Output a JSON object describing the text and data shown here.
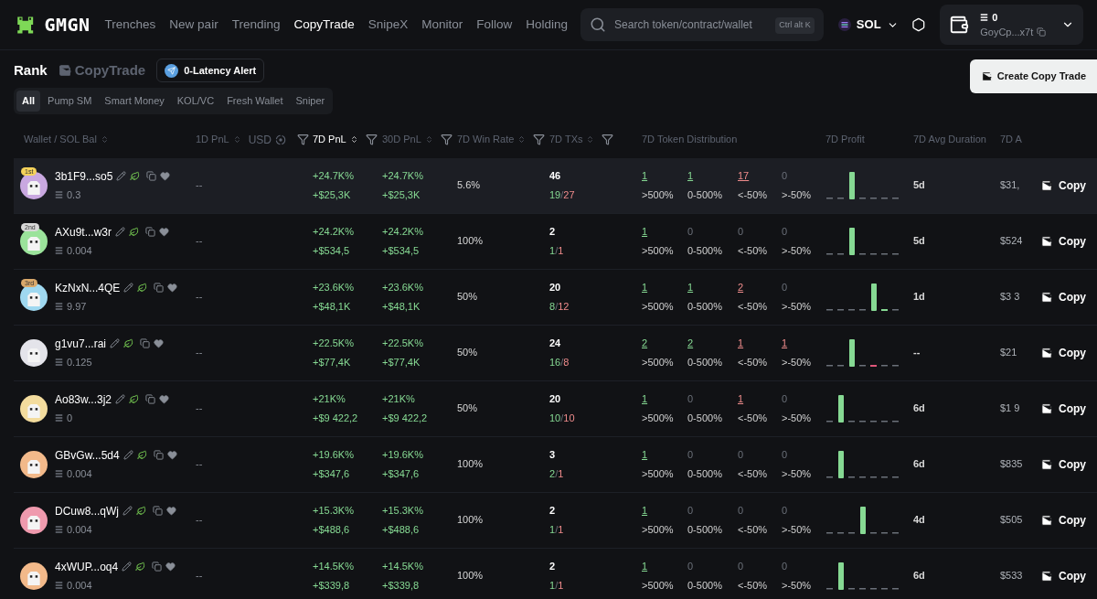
{
  "nav": {
    "logo": "GMGN",
    "links": [
      {
        "label": "Trenches",
        "selected": false
      },
      {
        "label": "New pair",
        "selected": false
      },
      {
        "label": "Trending",
        "selected": false
      },
      {
        "label": "CopyTrade",
        "selected": true
      },
      {
        "label": "SnipeX",
        "selected": false
      },
      {
        "label": "Monitor",
        "selected": false
      },
      {
        "label": "Follow",
        "selected": false
      },
      {
        "label": "Holding",
        "selected": false
      }
    ],
    "search": {
      "placeholder": "Search token/contract/wallet",
      "shortcut": "Ctrl alt K"
    },
    "chain": "SOL",
    "wallet": {
      "balance": "0",
      "address": "GoyCp...x7t"
    }
  },
  "heading": {
    "title": "Rank",
    "subtitle": "CopyTrade",
    "alert_button": "0-Latency Alert",
    "create_button": "Create Copy Trade"
  },
  "filters": [
    {
      "label": "All",
      "selected": true
    },
    {
      "label": "Pump SM",
      "selected": false
    },
    {
      "label": "Smart Money",
      "selected": false
    },
    {
      "label": "KOL/VC",
      "selected": false
    },
    {
      "label": "Fresh Wallet",
      "selected": false
    },
    {
      "label": "Sniper",
      "selected": false
    }
  ],
  "columns": [
    {
      "label": "Wallet / SOL Bal",
      "kind": "sort",
      "selected": false
    },
    {
      "label": "1D PnL",
      "kind": "sort_usd",
      "extra": "USD",
      "selected": false
    },
    {
      "label": "7D PnL",
      "kind": "sort_filter",
      "selected": true
    },
    {
      "label": "30D PnL",
      "kind": "sort_filter",
      "selected": false
    },
    {
      "label": "7D Win Rate",
      "kind": "sort_filter",
      "selected": false
    },
    {
      "label": "7D TXs",
      "kind": "sort_filter",
      "selected": false
    },
    {
      "label": "7D Token Distribution",
      "kind": "plain",
      "selected": false
    },
    {
      "label": "7D Profit",
      "kind": "plain",
      "selected": false
    },
    {
      "label": "7D Avg Duration",
      "kind": "plain",
      "selected": false
    },
    {
      "label": "7D A",
      "kind": "plain",
      "selected": false
    }
  ],
  "rows": [
    {
      "highlighted": true,
      "rank": {
        "label": "1st",
        "color": "#f5d25a"
      },
      "avatar": {
        "color": "#c9a8e0"
      },
      "wallet": "3b1F9...so5",
      "balance": "0.3",
      "pnl_1d": "--",
      "pnl_7d": [
        "+24.7K%",
        "+$25,3K"
      ],
      "pnl_30d": [
        "+24.7K%",
        "+$25,3K"
      ],
      "win_rate": "5.6%",
      "txs": "46",
      "wins": "19",
      "tx_separator": "/",
      "losses": "27",
      "distribution": [
        {
          "value": "1",
          "label": ">500%",
          "kind": "win"
        },
        {
          "value": "1",
          "label": "0-500%",
          "kind": "win"
        },
        {
          "value": "17",
          "label": "<-50%",
          "kind": "loss"
        },
        {
          "value": "0",
          "label": ">-50%",
          "kind": "none"
        }
      ],
      "profit_bars": [
        {
          "kind": "flat"
        },
        {
          "kind": "flat"
        },
        {
          "kind": "gain"
        },
        {
          "kind": "flat"
        },
        {
          "kind": "flat"
        },
        {
          "kind": "flat"
        },
        {
          "kind": "flat"
        }
      ],
      "avg_duration": "5d",
      "col_7d_a": "$31,",
      "copy": "Copy"
    },
    {
      "highlighted": false,
      "rank": {
        "label": "2nd",
        "color": "#d8d8d8"
      },
      "avatar": {
        "color": "#9be39b"
      },
      "wallet": "AXu9t...w3r",
      "balance": "0.004",
      "pnl_1d": "--",
      "pnl_7d": [
        "+24.2K%",
        "+$534,5"
      ],
      "pnl_30d": [
        "+24.2K%",
        "+$534,5"
      ],
      "win_rate": "100%",
      "txs": "2",
      "wins": "1",
      "tx_separator": "/",
      "losses": "1",
      "distribution": [
        {
          "value": "1",
          "label": ">500%",
          "kind": "win"
        },
        {
          "value": "0",
          "label": "0-500%",
          "kind": "none"
        },
        {
          "value": "0",
          "label": "<-50%",
          "kind": "none"
        },
        {
          "value": "0",
          "label": ">-50%",
          "kind": "none"
        }
      ],
      "profit_bars": [
        {
          "kind": "flat"
        },
        {
          "kind": "flat"
        },
        {
          "kind": "gain"
        },
        {
          "kind": "flat"
        },
        {
          "kind": "flat"
        },
        {
          "kind": "flat"
        },
        {
          "kind": "flat"
        }
      ],
      "avg_duration": "5d",
      "col_7d_a": "$524",
      "copy": "Copy"
    },
    {
      "highlighted": false,
      "rank": {
        "label": "3rd",
        "color": "#d9a86a"
      },
      "avatar": {
        "color": "#9fd8f0"
      },
      "wallet": "KzNxN...4QE",
      "balance": "9.97",
      "pnl_1d": "--",
      "pnl_7d": [
        "+23.6K%",
        "+$48,1K"
      ],
      "pnl_30d": [
        "+23.6K%",
        "+$48,1K"
      ],
      "win_rate": "50%",
      "txs": "20",
      "wins": "8",
      "tx_separator": "/",
      "losses": "12",
      "distribution": [
        {
          "value": "1",
          "label": ">500%",
          "kind": "win"
        },
        {
          "value": "1",
          "label": "0-500%",
          "kind": "win"
        },
        {
          "value": "2",
          "label": "<-50%",
          "kind": "loss"
        },
        {
          "value": "0",
          "label": ">-50%",
          "kind": "none"
        }
      ],
      "profit_bars": [
        {
          "kind": "flat"
        },
        {
          "kind": "flat"
        },
        {
          "kind": "flat"
        },
        {
          "kind": "flat"
        },
        {
          "kind": "gain"
        },
        {
          "kind": "small_gain"
        },
        {
          "kind": "flat"
        }
      ],
      "avg_duration": "1d",
      "col_7d_a": "$3 3",
      "copy": "Copy"
    },
    {
      "highlighted": false,
      "rank": null,
      "avatar": {
        "color": "#e4e4ea"
      },
      "wallet": "g1vu7...rai",
      "balance": "0.125",
      "pnl_1d": "--",
      "pnl_7d": [
        "+22.5K%",
        "+$77,4K"
      ],
      "pnl_30d": [
        "+22.5K%",
        "+$77,4K"
      ],
      "win_rate": "50%",
      "txs": "24",
      "wins": "16",
      "tx_separator": "/",
      "losses": "8",
      "distribution": [
        {
          "value": "2",
          "label": ">500%",
          "kind": "win"
        },
        {
          "value": "2",
          "label": "0-500%",
          "kind": "win"
        },
        {
          "value": "1",
          "label": "<-50%",
          "kind": "loss"
        },
        {
          "value": "1",
          "label": ">-50%",
          "kind": "loss"
        }
      ],
      "profit_bars": [
        {
          "kind": "flat"
        },
        {
          "kind": "flat"
        },
        {
          "kind": "gain"
        },
        {
          "kind": "flat"
        },
        {
          "kind": "loss"
        },
        {
          "kind": "flat"
        },
        {
          "kind": "flat"
        }
      ],
      "avg_duration": "--",
      "col_7d_a": "$21",
      "copy": "Copy"
    },
    {
      "highlighted": false,
      "rank": null,
      "avatar": {
        "color": "#f3dc9e"
      },
      "wallet": "Ao83w...3j2",
      "balance": "0",
      "pnl_1d": "--",
      "pnl_7d": [
        "+21K%",
        "+$9 422,2"
      ],
      "pnl_30d": [
        "+21K%",
        "+$9 422,2"
      ],
      "win_rate": "50%",
      "txs": "20",
      "wins": "10",
      "tx_separator": "/",
      "losses": "10",
      "distribution": [
        {
          "value": "1",
          "label": ">500%",
          "kind": "win"
        },
        {
          "value": "0",
          "label": "0-500%",
          "kind": "none"
        },
        {
          "value": "1",
          "label": "<-50%",
          "kind": "loss"
        },
        {
          "value": "0",
          "label": ">-50%",
          "kind": "none"
        }
      ],
      "profit_bars": [
        {
          "kind": "flat"
        },
        {
          "kind": "gain"
        },
        {
          "kind": "flat"
        },
        {
          "kind": "flat"
        },
        {
          "kind": "flat"
        },
        {
          "kind": "flat"
        },
        {
          "kind": "flat"
        }
      ],
      "avg_duration": "6d",
      "col_7d_a": "$1 9",
      "copy": "Copy"
    },
    {
      "highlighted": false,
      "rank": null,
      "avatar": {
        "color": "#f2b98a"
      },
      "wallet": "GBvGw...5d4",
      "balance": "0.004",
      "pnl_1d": "--",
      "pnl_7d": [
        "+19.6K%",
        "+$347,6"
      ],
      "pnl_30d": [
        "+19.6K%",
        "+$347,6"
      ],
      "win_rate": "100%",
      "txs": "3",
      "wins": "2",
      "tx_separator": "/",
      "losses": "1",
      "distribution": [
        {
          "value": "1",
          "label": ">500%",
          "kind": "win"
        },
        {
          "value": "0",
          "label": "0-500%",
          "kind": "none"
        },
        {
          "value": "0",
          "label": "<-50%",
          "kind": "none"
        },
        {
          "value": "0",
          "label": ">-50%",
          "kind": "none"
        }
      ],
      "profit_bars": [
        {
          "kind": "flat"
        },
        {
          "kind": "gain"
        },
        {
          "kind": "flat"
        },
        {
          "kind": "flat"
        },
        {
          "kind": "flat"
        },
        {
          "kind": "flat"
        },
        {
          "kind": "flat"
        }
      ],
      "avg_duration": "6d",
      "col_7d_a": "$835",
      "copy": "Copy"
    },
    {
      "highlighted": false,
      "rank": null,
      "avatar": {
        "color": "#ef9aae"
      },
      "wallet": "DCuw8...qWj",
      "balance": "0.004",
      "pnl_1d": "--",
      "pnl_7d": [
        "+15.3K%",
        "+$488,6"
      ],
      "pnl_30d": [
        "+15.3K%",
        "+$488,6"
      ],
      "win_rate": "100%",
      "txs": "2",
      "wins": "1",
      "tx_separator": "/",
      "losses": "1",
      "distribution": [
        {
          "value": "1",
          "label": ">500%",
          "kind": "win"
        },
        {
          "value": "0",
          "label": "0-500%",
          "kind": "none"
        },
        {
          "value": "0",
          "label": "<-50%",
          "kind": "none"
        },
        {
          "value": "0",
          "label": ">-50%",
          "kind": "none"
        }
      ],
      "profit_bars": [
        {
          "kind": "flat"
        },
        {
          "kind": "flat"
        },
        {
          "kind": "flat"
        },
        {
          "kind": "gain"
        },
        {
          "kind": "flat"
        },
        {
          "kind": "flat"
        },
        {
          "kind": "flat"
        }
      ],
      "avg_duration": "4d",
      "col_7d_a": "$505",
      "copy": "Copy"
    },
    {
      "highlighted": false,
      "rank": null,
      "avatar": {
        "color": "#f2b98a"
      },
      "wallet": "4xWUP...oq4",
      "balance": "0.004",
      "pnl_1d": "--",
      "pnl_7d": [
        "+14.5K%",
        "+$339,8"
      ],
      "pnl_30d": [
        "+14.5K%",
        "+$339,8"
      ],
      "win_rate": "100%",
      "txs": "2",
      "wins": "1",
      "tx_separator": "/",
      "losses": "1",
      "distribution": [
        {
          "value": "1",
          "label": ">500%",
          "kind": "win"
        },
        {
          "value": "0",
          "label": "0-500%",
          "kind": "none"
        },
        {
          "value": "0",
          "label": "<-50%",
          "kind": "none"
        },
        {
          "value": "0",
          "label": ">-50%",
          "kind": "none"
        }
      ],
      "profit_bars": [
        {
          "kind": "flat"
        },
        {
          "kind": "gain"
        },
        {
          "kind": "flat"
        },
        {
          "kind": "flat"
        },
        {
          "kind": "flat"
        },
        {
          "kind": "flat"
        },
        {
          "kind": "flat"
        }
      ],
      "avg_duration": "6d",
      "col_7d_a": "$533",
      "copy": "Copy"
    }
  ]
}
